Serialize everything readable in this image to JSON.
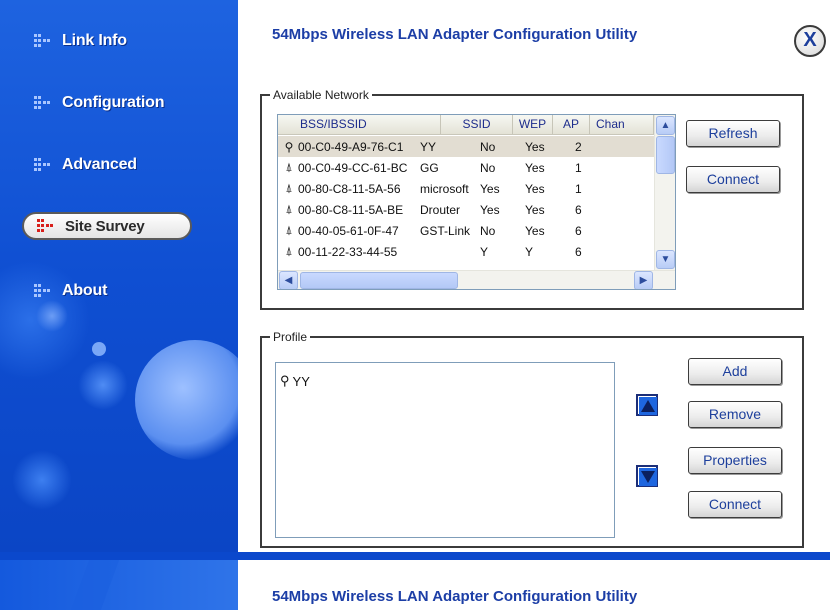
{
  "app": {
    "title": "54Mbps Wireless LAN Adapter Configuration Utility",
    "close_label": "X"
  },
  "nav": {
    "items": [
      {
        "label": "Link Info"
      },
      {
        "label": "Configuration"
      },
      {
        "label": "Advanced"
      },
      {
        "label": "Site Survey",
        "active": true
      },
      {
        "label": "About"
      }
    ]
  },
  "available_network": {
    "legend": "Available Network",
    "columns": [
      "BSS/IBSSID",
      "SSID",
      "WEP",
      "AP",
      "Chan"
    ],
    "rows": [
      {
        "icon": "ap-icon",
        "bssid": "00-C0-49-A9-76-C1",
        "ssid": "YY",
        "wep": "No",
        "ap": "Yes",
        "chan": "2",
        "selected": true
      },
      {
        "icon": "antenna-icon",
        "bssid": "00-C0-49-CC-61-BC",
        "ssid": "GG",
        "wep": "No",
        "ap": "Yes",
        "chan": "1"
      },
      {
        "icon": "antenna-icon",
        "bssid": "00-80-C8-11-5A-56",
        "ssid": "microsoft",
        "wep": "Yes",
        "ap": "Yes",
        "chan": "1"
      },
      {
        "icon": "antenna-icon",
        "bssid": "00-80-C8-11-5A-BE",
        "ssid": "Drouter",
        "wep": "Yes",
        "ap": "Yes",
        "chan": "6"
      },
      {
        "icon": "antenna-icon",
        "bssid": "00-40-05-61-0F-47",
        "ssid": "GST-Link",
        "wep": "No",
        "ap": "Yes",
        "chan": "6"
      },
      {
        "icon": "antenna-icon",
        "bssid": "00-11-22-33-44-55",
        "ssid": "",
        "wep": "Y",
        "ap": "Y",
        "chan": "6"
      }
    ],
    "refresh_label": "Refresh",
    "connect_label": "Connect"
  },
  "profile": {
    "legend": "Profile",
    "items": [
      {
        "icon": "ap-icon",
        "name": "YY"
      }
    ],
    "add_label": "Add",
    "remove_label": "Remove",
    "properties_label": "Properties",
    "connect_label": "Connect"
  },
  "footer": {
    "title": "54Mbps Wireless LAN Adapter Configuration Utility"
  },
  "colors": {
    "accent": "#1c3ea6",
    "sidebar": "#0f4fd2",
    "active_icon": "#d8201b"
  }
}
